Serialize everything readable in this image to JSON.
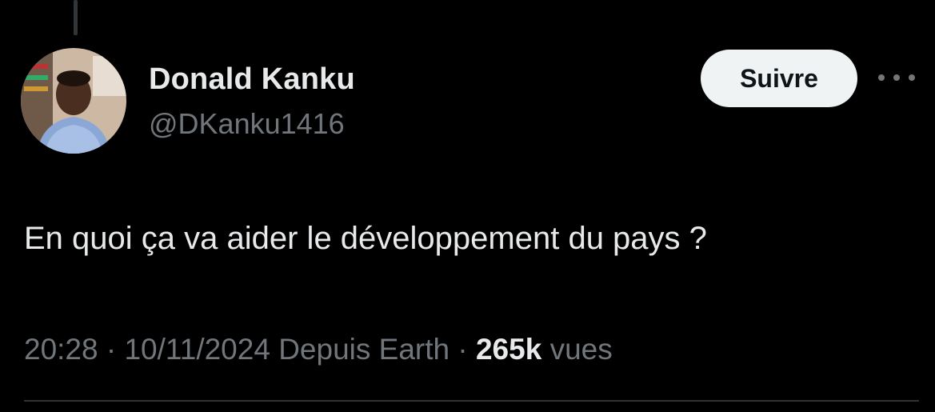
{
  "colors": {
    "background": "#000000",
    "primary_text": "#e7e9ea",
    "secondary_text": "#71767b",
    "button_bg": "#eff3f4"
  },
  "author": {
    "name": "Donald Kanku",
    "handle": "@DKanku1416"
  },
  "actions": {
    "follow_label": "Suivre",
    "more_icon": "more-horizontal-icon"
  },
  "tweet": {
    "text": "En quoi ça va aider le développement du pays ?",
    "time": "20:28",
    "separator": "·",
    "date": "10/11/2024",
    "source": "Depuis Earth",
    "views_count": "265k",
    "views_label": "vues"
  }
}
